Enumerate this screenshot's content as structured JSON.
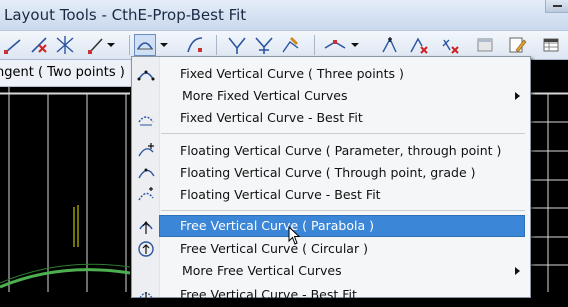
{
  "window": {
    "title": "Layout Tools - CthE-Prop-Best Fit"
  },
  "prompt": {
    "text": "ngent ( Two points )"
  },
  "toolbar": {
    "icons": [
      "line-tool-icon",
      "delete-element-icon",
      "intersect-icon",
      "arrow-line-icon",
      "vertical-curve-dropdown-icon",
      "curve-tool-icon",
      "grade-tool-icon",
      "merge-tool-icon",
      "edit-grade-icon",
      "insert-pvi-icon",
      "move-pvi-icon",
      "delete-pvi-icon",
      "properties-icon",
      "edit-icon",
      "table-icon"
    ]
  },
  "menu": {
    "items": [
      {
        "label": "Fixed Vertical Curve ( Three points )",
        "icon": "three-point-curve-icon"
      },
      {
        "label": "More Fixed Vertical Curves",
        "submenu": true
      },
      {
        "label": "Fixed Vertical Curve - Best Fit",
        "icon": "best-fit-curve-icon"
      },
      {
        "label": "Floating Vertical Curve ( Parameter, through point )",
        "icon": "float-param-curve-icon"
      },
      {
        "label": "Floating Vertical Curve ( Through point, grade )",
        "icon": "float-grade-curve-icon"
      },
      {
        "label": "Floating Vertical Curve - Best Fit",
        "icon": "float-best-fit-icon"
      },
      {
        "label": "Free Vertical Curve ( Parabola )",
        "icon": "parabola-curve-icon",
        "selected": true
      },
      {
        "label": "Free Vertical Curve ( Circular )",
        "icon": "circular-curve-icon"
      },
      {
        "label": "More Free Vertical Curves",
        "submenu": true
      },
      {
        "label": "Free Vertical Curve - Best Fit",
        "icon": "free-best-fit-icon"
      }
    ]
  },
  "colors": {
    "highlight": "#3b86d6",
    "canvas": "#000000",
    "grid": "#ffffff",
    "profile": "#4caf50",
    "label": "#e8e800"
  }
}
